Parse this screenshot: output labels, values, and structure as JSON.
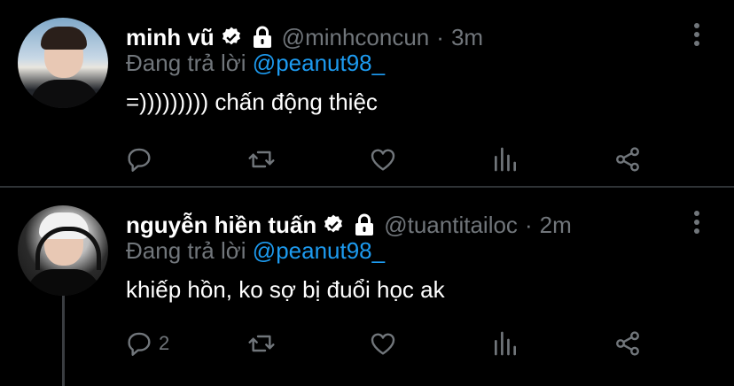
{
  "tweets": [
    {
      "name": "minh vũ",
      "handle": "@minhconcun",
      "separator": "·",
      "time": "3m",
      "replying_prefix": "Đang trả lời",
      "replying_to": "@peanut98_",
      "text": "=))))))))) chấn động thiệc",
      "reply_count": "",
      "icons": [
        "verified-icon",
        "lock-icon",
        "more-icon",
        "reply-icon",
        "retweet-icon",
        "like-icon",
        "stats-icon",
        "share-icon"
      ]
    },
    {
      "name": "nguyễn hiền tuấn",
      "handle": "@tuantitailoc",
      "separator": "·",
      "time": "2m",
      "replying_prefix": "Đang trả lời",
      "replying_to": "@peanut98_",
      "text": "khiếp hồn, ko sợ bị đuổi học ak",
      "reply_count": "2",
      "icons": [
        "verified-icon",
        "lock-icon",
        "more-icon",
        "reply-icon",
        "retweet-icon",
        "like-icon",
        "stats-icon",
        "share-icon"
      ]
    }
  ],
  "colors": {
    "background": "#000000",
    "text": "#ffffff",
    "secondary": "#71767b",
    "mention": "#1d9bf0",
    "divider": "#2f3336"
  }
}
